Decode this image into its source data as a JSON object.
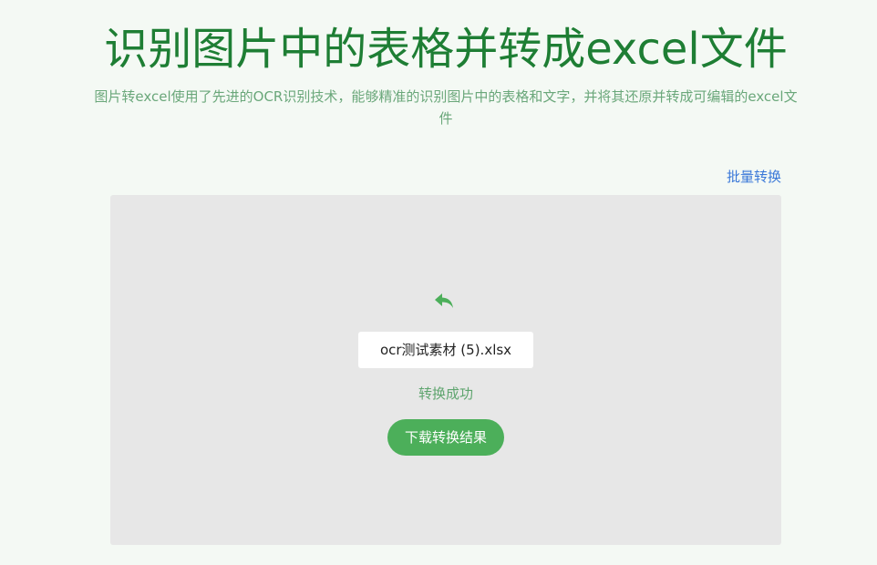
{
  "header": {
    "title": "识别图片中的表格并转成excel文件",
    "subtitle": "图片转excel使用了先进的OCR识别技术，能够精准的识别图片中的表格和文字，并将其还原并转成可编辑的excel文件"
  },
  "links": {
    "batch": "批量转换"
  },
  "result": {
    "file_name": "ocr测试素材 (5).xlsx",
    "status": "转换成功",
    "download_label": "下载转换结果",
    "back_icon": "undo-arrow-icon"
  },
  "colors": {
    "title": "#1e7e34",
    "subtitle": "#6aa77a",
    "link": "#3a78d8",
    "panel_bg": "#e7e7e7",
    "accent": "#4caf5a",
    "status": "#5fa56f",
    "page_bg": "#f4f9f4"
  }
}
